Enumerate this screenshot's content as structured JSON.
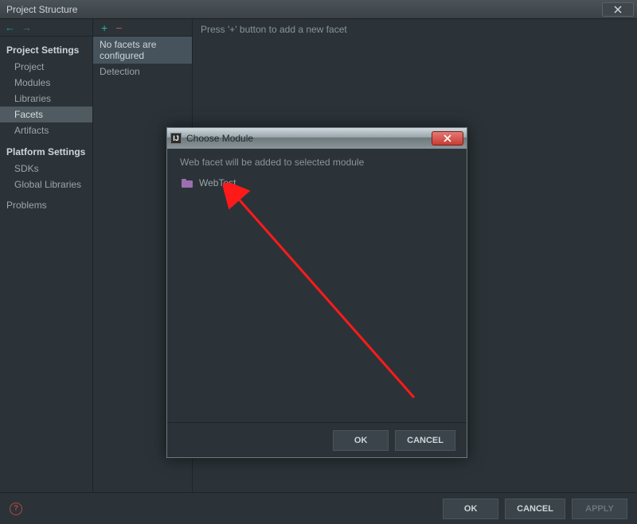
{
  "window": {
    "title": "Project Structure"
  },
  "sidebar": {
    "section1_header": "Project Settings",
    "section1_items": [
      "Project",
      "Modules",
      "Libraries",
      "Facets",
      "Artifacts"
    ],
    "section1_selected": "Facets",
    "section2_header": "Platform Settings",
    "section2_items": [
      "SDKs",
      "Global Libraries"
    ],
    "section3_items": [
      "Problems"
    ]
  },
  "facets": {
    "rows": [
      "No facets are configured",
      "Detection"
    ],
    "selected": "No facets are configured"
  },
  "hint_text": "Press '+' button to add a new facet",
  "main_buttons": {
    "ok": "OK",
    "cancel": "CANCEL",
    "apply": "APPLY"
  },
  "dialog": {
    "title": "Choose Module",
    "hint": "Web facet will be added to selected module",
    "modules": [
      "WebTest"
    ],
    "ok": "OK",
    "cancel": "CANCEL"
  }
}
